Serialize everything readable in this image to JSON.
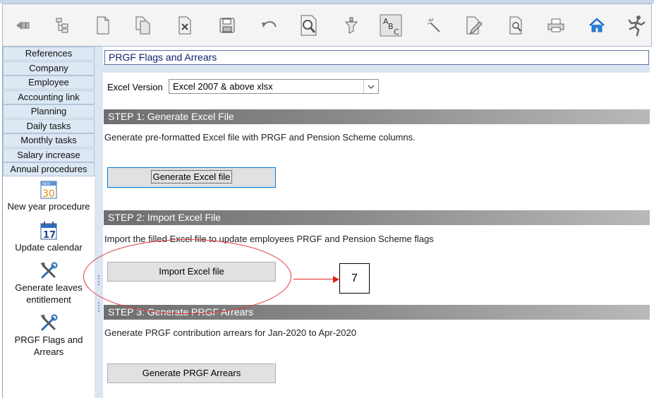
{
  "toolbar": {
    "icons": [
      {
        "name": "back-icon",
        "label": ""
      },
      {
        "name": "tree-icon",
        "label": ""
      },
      {
        "name": "new-document-icon",
        "label": ""
      },
      {
        "name": "copy-document-icon",
        "label": ""
      },
      {
        "name": "delete-document-icon",
        "label": ""
      },
      {
        "name": "save-icon",
        "label": ""
      },
      {
        "name": "undo-icon",
        "label": ""
      },
      {
        "name": "search-document-icon",
        "label": ""
      },
      {
        "name": "filter-icon",
        "label": ""
      },
      {
        "name": "spelling-abc-icon",
        "label": ""
      },
      {
        "name": "magic-wand-icon",
        "label": ""
      },
      {
        "name": "edit-document-icon",
        "label": ""
      },
      {
        "name": "preview-document-icon",
        "label": ""
      },
      {
        "name": "print-icon",
        "label": ""
      },
      {
        "name": "home-icon",
        "label": ""
      },
      {
        "name": "exit-runner-icon",
        "label": ""
      }
    ]
  },
  "nav": {
    "items": [
      {
        "label": "References"
      },
      {
        "label": "Company"
      },
      {
        "label": "Employee"
      },
      {
        "label": "Accounting link"
      },
      {
        "label": "Planning"
      },
      {
        "label": "Daily tasks"
      },
      {
        "label": "Monthly tasks"
      },
      {
        "label": "Salary increase"
      },
      {
        "label": "Annual procedures"
      }
    ],
    "tools": [
      {
        "label": "New year procedure",
        "icon": "calendar-30-icon",
        "icon_text": "30",
        "icon_small": "NOV"
      },
      {
        "label": "Update calendar",
        "icon": "calendar-17-icon",
        "icon_text": "17"
      },
      {
        "label": "Generate leaves entitlement",
        "icon": "tools-icon"
      },
      {
        "label": "PRGF Flags and Arrears",
        "icon": "tools-icon"
      }
    ]
  },
  "main": {
    "title": "PRGF Flags and Arrears",
    "excel_version_label": "Excel Version",
    "excel_version_value": "Excel 2007 & above xlsx",
    "steps": [
      {
        "header": "STEP 1: Generate Excel File",
        "description": "Generate pre-formatted Excel file with PRGF and Pension Scheme columns.",
        "button": "Generate Excel file"
      },
      {
        "header": "STEP 2: Import Excel File",
        "description": "Import the filled Excel file to update employees PRGF and  Pension Scheme flags",
        "button": "Import Excel file"
      },
      {
        "header": "STEP 3: Generate PRGF Arrears",
        "description": "Generate PRGF contribution arrears for Jan-2020 to Apr-2020",
        "button": "Generate PRGF Arrears"
      }
    ]
  },
  "annotation": {
    "callout_number": "7",
    "color": "#e02020"
  }
}
